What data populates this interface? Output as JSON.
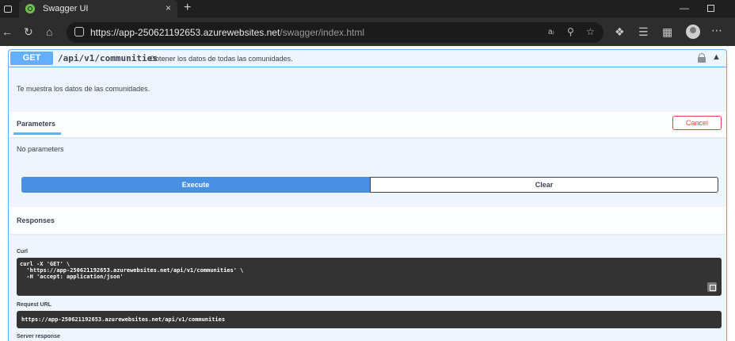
{
  "browser": {
    "tab_title": "Swagger UI",
    "tab_close": "×",
    "new_tab": "+",
    "url_host": "https://app-250621192653.azurewebsites.net",
    "url_path": "/swagger/index.html"
  },
  "operation": {
    "method": "GET",
    "path": "/api/v1/communities",
    "summary": "Obtener los datos de todas las comunidades.",
    "description": "Te muestra los datos de las comunidades."
  },
  "parameters": {
    "title": "Parameters",
    "cancel_label": "Cancel",
    "empty_text": "No parameters"
  },
  "actions": {
    "execute_label": "Execute",
    "clear_label": "Clear"
  },
  "responses": {
    "title": "Responses",
    "curl_label": "Curl",
    "curl_line1": "curl -X 'GET' \\",
    "curl_line2": "  'https://app-250621192653.azurewebsites.net/api/v1/communities' \\",
    "curl_line3": "  -H 'accept: application/json'",
    "request_url_label": "Request URL",
    "request_url": "https://app-250621192653.azurewebsites.net/api/v1/communities",
    "server_response_label": "Server response"
  },
  "colors": {
    "get_accent": "#61affe",
    "execute": "#4990e2",
    "cancel": "#f93e3e",
    "code_bg": "#333333"
  }
}
